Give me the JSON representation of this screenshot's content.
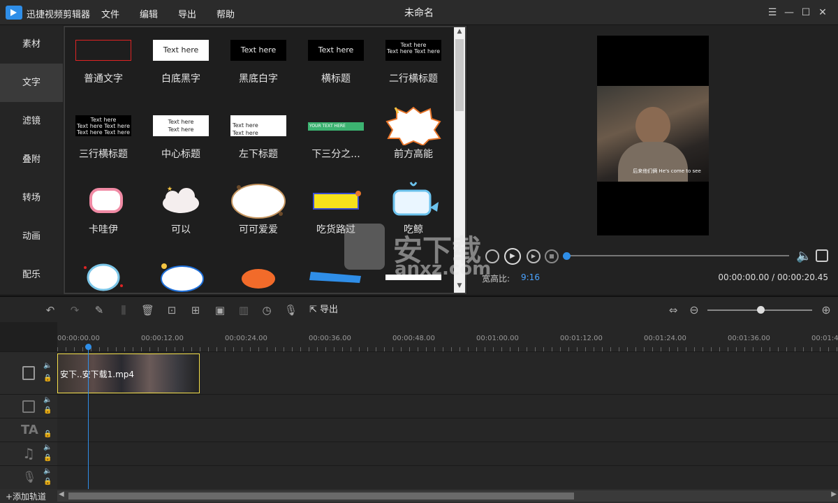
{
  "app": {
    "name": "迅捷视频剪辑器",
    "doc_title": "未命名"
  },
  "menu": [
    "文件",
    "编辑",
    "导出",
    "帮助"
  ],
  "sidebar": [
    "素材",
    "文字",
    "滤镜",
    "叠附",
    "转场",
    "动画",
    "配乐"
  ],
  "text_templates": [
    {
      "label": "普通文字",
      "sample": ""
    },
    {
      "label": "白底黑字",
      "sample": "Text here"
    },
    {
      "label": "黑底白字",
      "sample": "Text here"
    },
    {
      "label": "横标题",
      "sample": "Text here"
    },
    {
      "label": "二行横标题",
      "sample": "Text here\nText here Text here"
    },
    {
      "label": "三行横标题",
      "sample": "Text here\nText here Text here\nText here Text here"
    },
    {
      "label": "中心标题",
      "sample": "Text here\nText here"
    },
    {
      "label": "左下标题",
      "sample": "Text here\nText here"
    },
    {
      "label": "下三分之...",
      "sample": "YOUR TEXT HERE"
    },
    {
      "label": "前方高能",
      "sample": ""
    },
    {
      "label": "卡哇伊",
      "sample": ""
    },
    {
      "label": "可以",
      "sample": ""
    },
    {
      "label": "可可爱爱",
      "sample": ""
    },
    {
      "label": "吃货路过",
      "sample": ""
    },
    {
      "label": "吃鲸",
      "sample": ""
    }
  ],
  "preview": {
    "subtitle": "后来他们俩 He's come to see",
    "aspect_label": "宽高比:",
    "aspect_value": "9:16",
    "time": "00:00:00.00 / 00:00:20.45",
    "watermark": "安下载",
    "watermark_url": "anxz.com"
  },
  "timeline": {
    "export_label": "导出",
    "ruler": [
      "00:00:00.00",
      "00:00:12.00",
      "00:00:24.00",
      "00:00:36.00",
      "00:00:48.00",
      "00:01:00.00",
      "00:01:12.00",
      "00:01:24.00",
      "00:01:36.00",
      "00:01:4"
    ],
    "clip_label": "安下..安下载1.mp4",
    "add_track": "+添加轨道"
  },
  "colors": {
    "accent": "#2f8ee8",
    "clip_border": "#f5e04b",
    "aspect": "#4aa3ff"
  }
}
